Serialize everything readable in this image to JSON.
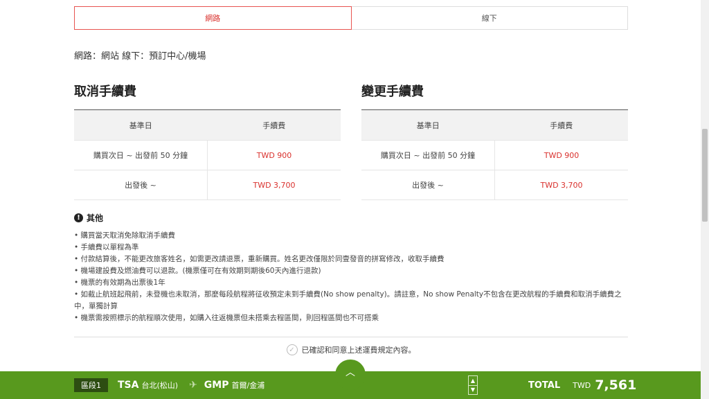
{
  "tabs": [
    {
      "label": "網路",
      "active": true
    },
    {
      "label": "線下",
      "active": false
    }
  ],
  "info_line": "網路：網站 線下：預訂中心/機場",
  "cancel": {
    "title": "取消手續費",
    "headers": [
      "基準日",
      "手續費"
    ],
    "rows": [
      {
        "date": "購買次日 ~ 出發前 50 分鐘",
        "fee": "TWD 900"
      },
      {
        "date": "出發後 ~",
        "fee": "TWD 3,700"
      }
    ]
  },
  "change": {
    "title": "變更手續費",
    "headers": [
      "基準日",
      "手續費"
    ],
    "rows": [
      {
        "date": "購買次日 ~ 出發前 50 分鐘",
        "fee": "TWD 900"
      },
      {
        "date": "出發後 ~",
        "fee": "TWD 3,700"
      }
    ]
  },
  "notes": {
    "title": "其他",
    "items": [
      "購買當天取消免除取消手續費",
      "手續費以單程為準",
      "付款結算後，不能更改旅客姓名，如需更改請退票，重新購買。姓名更改僅限於同壹發音的拼寫修改，收取手續費",
      "機場建設費及燃油費可以退款。(機票僅可在有效期到期後60天內進行退款)",
      "機票的有效期為出票後1年",
      "如截止航班起飛前，未登機也未取消，那麼每段航程將征收預定未到手續費(No show penalty)。請註意，No show Penalty不包含在更改航程的手續費和取消手續費之中，單獨計算",
      "機票需按照標示的航程順次使用，如購入往返機票但未搭乘去程區間，則回程區間也不可搭乘"
    ]
  },
  "confirm_text": "已確認和同意上述運費規定內容。",
  "footer": {
    "segment": "區段1",
    "from_code": "TSA",
    "from_city": "台北(松山)",
    "to_code": "GMP",
    "to_city": "首爾/金浦",
    "total_label": "TOTAL",
    "currency": "TWD",
    "amount": "7,561"
  },
  "colors": {
    "accent_red": "#d9302c",
    "footer_green": "#58991e",
    "badge_dark": "#2d4d12"
  }
}
